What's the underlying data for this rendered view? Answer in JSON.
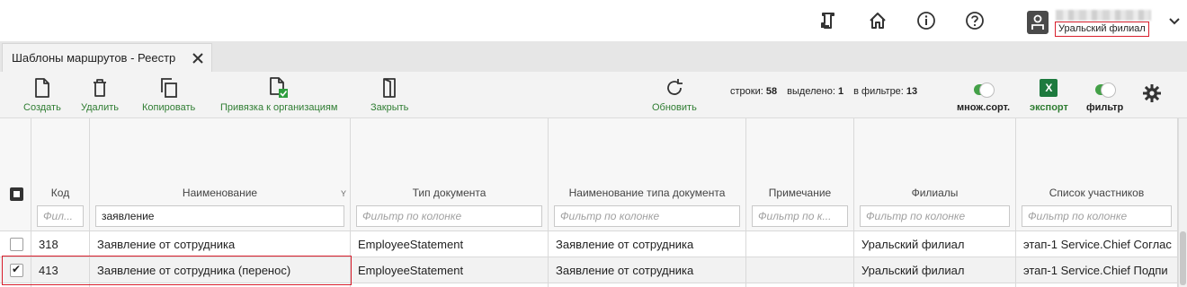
{
  "header": {
    "icons": [
      "monitor-icon",
      "home-icon",
      "info-icon",
      "help-icon"
    ],
    "user": {
      "branch": "Уральский филиал"
    }
  },
  "tab": {
    "label": "Шаблоны маршрутов - Реестр"
  },
  "toolbar": {
    "create": "Создать",
    "delete": "Удалить",
    "copy": "Копировать",
    "bind_org": "Привязка к организациям",
    "close": "Закрыть",
    "refresh": "Обновить",
    "stats": {
      "rows_label": "строки:",
      "rows_value": "58",
      "selected_label": "выделено:",
      "selected_value": "1",
      "filtered_label": "в фильтре:",
      "filtered_value": "13"
    },
    "multisort": "множ.сорт.",
    "export": "экспорт",
    "excel_letter": "X",
    "filter": "фильтр"
  },
  "grid": {
    "columns": [
      {
        "title": "Код",
        "filter_placeholder": "Фил...",
        "filter_value": ""
      },
      {
        "title": "Наименование",
        "filter_placeholder": "",
        "filter_value": "заявление",
        "sort_marker": "Y"
      },
      {
        "title": "Тип документа",
        "filter_placeholder": "Фильтр по колонке",
        "filter_value": ""
      },
      {
        "title": "Наименование типа документа",
        "filter_placeholder": "Фильтр по колонке",
        "filter_value": ""
      },
      {
        "title": "Примечание",
        "filter_placeholder": "Фильтр по к...",
        "filter_value": ""
      },
      {
        "title": "Филиалы",
        "filter_placeholder": "Фильтр по колонке",
        "filter_value": ""
      },
      {
        "title": "Список участников",
        "filter_placeholder": "Фильтр по колонке",
        "filter_value": ""
      }
    ],
    "rows": [
      {
        "checked": false,
        "code": "318",
        "name": "Заявление от сотрудника",
        "doc_type": "EmployeeStatement",
        "doc_type_name": "Заявление от сотрудника",
        "note": "",
        "branches": "Уральский филиал",
        "participants": "этап-1 Service.Chief Соглас"
      },
      {
        "checked": true,
        "code": "413",
        "name": "Заявление от сотрудника (перенос)",
        "doc_type": "EmployeeStatement",
        "doc_type_name": "Заявление от сотрудника",
        "note": "",
        "branches": "Уральский филиал",
        "participants": "этап-1 Service.Chief Подпи"
      }
    ]
  },
  "colors": {
    "accent_green": "#2f7d32",
    "highlight_red": "#d81e2c",
    "excel_green": "#1d7a3e"
  }
}
